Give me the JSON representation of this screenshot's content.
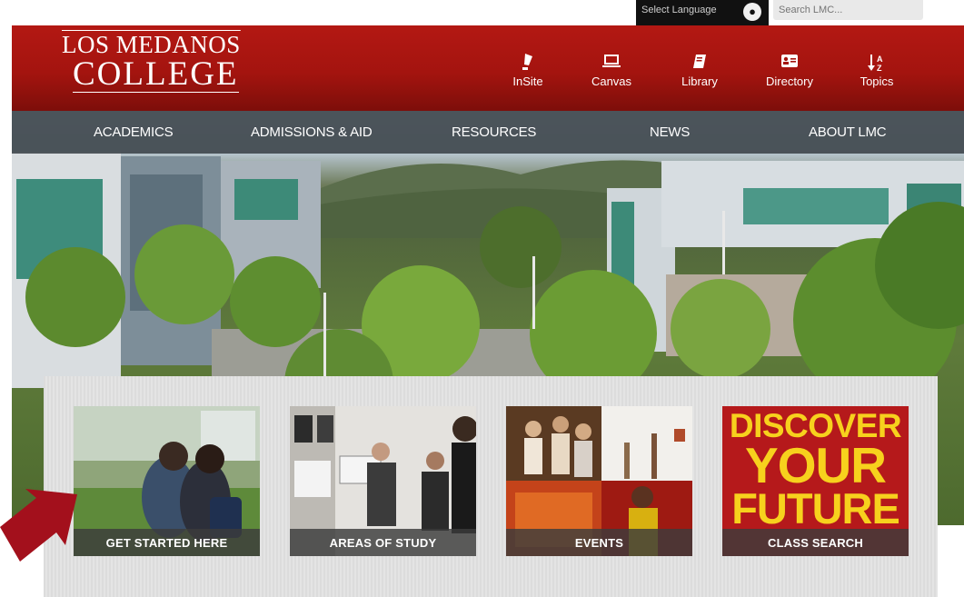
{
  "topbar": {
    "language_label": "Select Language",
    "search_placeholder": "Search LMC..."
  },
  "logo": {
    "line1": "LOS MEDANOS",
    "line2": "COLLEGE"
  },
  "quick_links": [
    {
      "label": "InSite",
      "icon": "pen-icon"
    },
    {
      "label": "Canvas",
      "icon": "laptop-icon"
    },
    {
      "label": "Library",
      "icon": "book-icon"
    },
    {
      "label": "Directory",
      "icon": "id-card-icon"
    },
    {
      "label": "Topics",
      "icon": "sort-az-icon"
    }
  ],
  "nav": {
    "items": [
      "ACADEMICS",
      "ADMISSIONS & AID",
      "RESOURCES",
      "NEWS",
      "ABOUT LMC"
    ]
  },
  "tiles": [
    {
      "caption": "GET STARTED HERE"
    },
    {
      "caption": "AREAS OF STUDY"
    },
    {
      "caption": "EVENTS"
    },
    {
      "caption": "CLASS SEARCH",
      "promo": [
        "DISCOVER",
        "YOUR",
        "FUTURE"
      ]
    }
  ],
  "colors": {
    "brand_red": "#a4140f",
    "nav_bg": "#3a4248",
    "promo_yellow": "#f7d11d",
    "arrow_red": "#a3101c"
  }
}
